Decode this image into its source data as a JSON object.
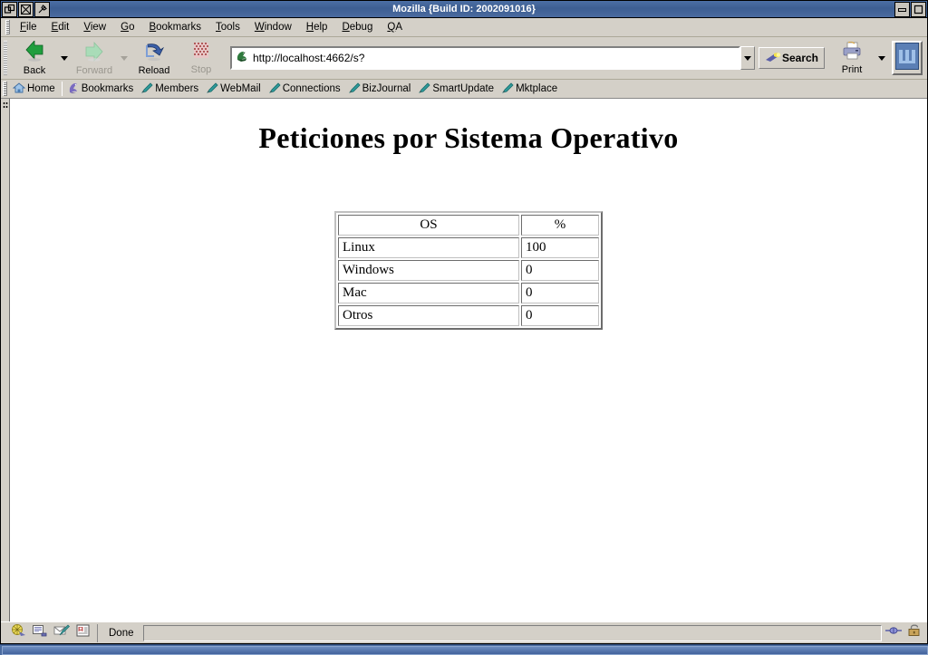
{
  "window": {
    "title": "Mozilla {Build ID: 2002091016}",
    "titlebar_icons": [
      "window-menu-icon",
      "shade-icon",
      "pin-icon"
    ],
    "controls": [
      "minimize-button",
      "maximize-button"
    ]
  },
  "menubar": {
    "items": [
      {
        "label": "File",
        "accel": "F"
      },
      {
        "label": "Edit",
        "accel": "E"
      },
      {
        "label": "View",
        "accel": "V"
      },
      {
        "label": "Go",
        "accel": "G"
      },
      {
        "label": "Bookmarks",
        "accel": "B"
      },
      {
        "label": "Tools",
        "accel": "T"
      },
      {
        "label": "Window",
        "accel": "W"
      },
      {
        "label": "Help",
        "accel": "H"
      },
      {
        "label": "Debug",
        "accel": "D"
      },
      {
        "label": "QA",
        "accel": "Q"
      }
    ]
  },
  "toolbar": {
    "back_label": "Back",
    "forward_label": "Forward",
    "reload_label": "Reload",
    "stop_label": "Stop",
    "search_label": "Search",
    "print_label": "Print",
    "back_enabled": true,
    "forward_enabled": false,
    "stop_enabled": false
  },
  "urlbar": {
    "value": "http://localhost:4662/s?",
    "placeholder": "",
    "favicon": "mozilla-lizard-icon"
  },
  "personalbar": {
    "items": [
      {
        "label": "Home",
        "icon": "home-icon"
      },
      {
        "label": "Bookmarks",
        "icon": "bookmarks-icon"
      },
      {
        "label": "Members",
        "icon": "pen-icon"
      },
      {
        "label": "WebMail",
        "icon": "pen-icon"
      },
      {
        "label": "Connections",
        "icon": "pen-icon"
      },
      {
        "label": "BizJournal",
        "icon": "pen-icon"
      },
      {
        "label": "SmartUpdate",
        "icon": "pen-icon"
      },
      {
        "label": "Mktplace",
        "icon": "pen-icon"
      }
    ]
  },
  "page": {
    "heading": "Peticiones por Sistema Operativo"
  },
  "chart_data": {
    "type": "table",
    "title": "Peticiones por Sistema Operativo",
    "columns": [
      "OS",
      "%"
    ],
    "rows": [
      {
        "os": "Linux",
        "pct": "100"
      },
      {
        "os": "Windows",
        "pct": "0"
      },
      {
        "os": "Mac",
        "pct": "0"
      },
      {
        "os": "Otros",
        "pct": "0"
      }
    ],
    "categories": [
      "Linux",
      "Windows",
      "Mac",
      "Otros"
    ],
    "values": [
      100,
      0,
      0,
      0
    ],
    "xlabel": "OS",
    "ylabel": "%",
    "ylim": [
      0,
      100
    ]
  },
  "statusbar": {
    "text": "Done",
    "icons": [
      "navigator-icon",
      "composer-icon",
      "mail-icon",
      "addressbook-icon"
    ],
    "right_icons": [
      "connection-icon",
      "security-lock-icon"
    ]
  },
  "colors": {
    "titlebar": "#3d5e92",
    "chrome": "#d4d0c8",
    "content": "#ffffff",
    "desktop": "#4a6ba0",
    "text": "#000000"
  }
}
